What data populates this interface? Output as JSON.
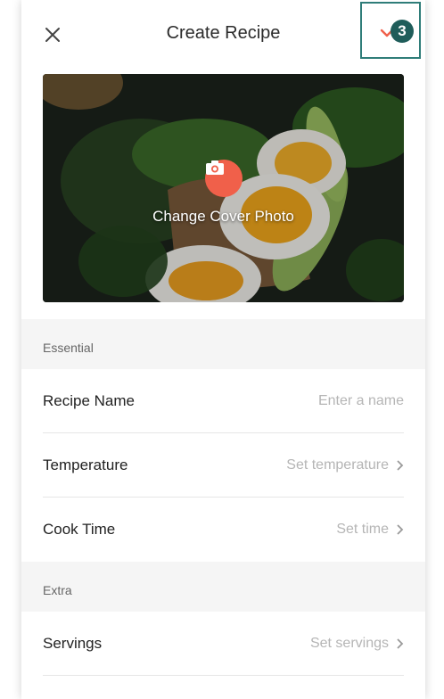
{
  "header": {
    "title": "Create Recipe",
    "close_icon": "close-icon",
    "confirm_icon": "checkmark-icon",
    "step_badge": "3",
    "colors": {
      "confirm": "#f0604a",
      "highlight_border": "#2f7d79",
      "badge": "#1f5d5a"
    }
  },
  "cover": {
    "label": "Change Cover Photo",
    "icon": "camera-icon",
    "accent": "#f0604a"
  },
  "sections": {
    "essential": {
      "title": "Essential",
      "rows": [
        {
          "label": "Recipe Name",
          "placeholder": "Enter a name"
        },
        {
          "label": "Temperature",
          "value": "Set temperature"
        },
        {
          "label": "Cook Time",
          "value": "Set time"
        }
      ]
    },
    "extra": {
      "title": "Extra",
      "rows": [
        {
          "label": "Servings",
          "value": "Set servings"
        }
      ]
    }
  }
}
